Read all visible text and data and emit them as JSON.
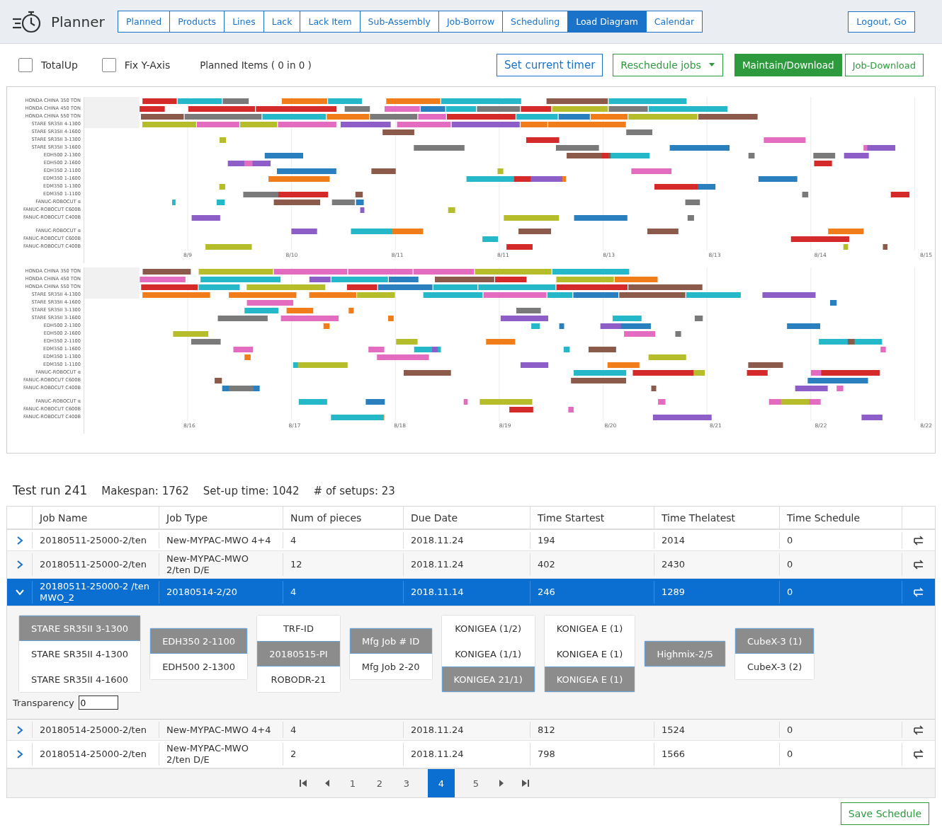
{
  "app": {
    "title": "Planner"
  },
  "nav": [
    {
      "label": "Planned",
      "selected": false
    },
    {
      "label": "Products",
      "selected": false
    },
    {
      "label": "Lines",
      "selected": false
    },
    {
      "label": "Lack",
      "selected": false
    },
    {
      "label": "Lack  Item",
      "selected": false
    },
    {
      "label": "Sub-Assembly",
      "selected": false
    },
    {
      "label": "Job-Borrow",
      "selected": false
    },
    {
      "label": "Scheduling",
      "selected": false
    },
    {
      "label": "Load Diagram",
      "selected": true
    },
    {
      "label": "Calendar",
      "selected": false
    }
  ],
  "logout": "Logout,  Go",
  "toolbar": {
    "checkboxes": [
      {
        "label": "TotalUp",
        "checked": false
      },
      {
        "label": "Fix Y-Axis",
        "checked": false
      }
    ],
    "planned_items": "Planned Items  ( 0 in 0 )",
    "set_timer": "Set current timer",
    "reschedule": "Reschedule jobs",
    "maintain": "Maintain/Download",
    "job_download": "Job-Download"
  },
  "gantt": {
    "panels": [
      {
        "row_groups": [
          [
            "HONDA CHINA  350 TON",
            "HONDA CHINA  450 TON",
            "HONDA CHINA  550 TON",
            "STARE  SR35II 4-1300",
            "STARE  SR35II 4-1600",
            "STARE  SR35II 3-1300",
            "STARE  SR35II 3-1600",
            "EDH500  2-1300",
            "EDH500  2-1600",
            "EDH350  2-1100",
            "EDM350  1-1600",
            "EDM350  1-1300",
            "EDM350  1-1100",
            "FANUC-ROBOCUT  α",
            "FANUC-ROBOCUT  C600B",
            "FANUC-ROBOCUT  C400B"
          ],
          [
            "FANUC-ROBOCUT  α",
            "FANUC-ROBOCUT  C600B",
            "FANUC-ROBOCUT  C400B"
          ]
        ],
        "ticks": [
          "8/9",
          "8/10",
          "8/11",
          "8/11",
          "8/13",
          "8/13",
          "8/14",
          "8/15"
        ]
      },
      {
        "row_groups": [
          [
            "HONDA CHINA  350 TON",
            "HONDA CHINA  450 TON",
            "HONDA CHINA  550 TON",
            "STARE  SR35II 4-1300",
            "STARE  SR35II 4-1600",
            "STARE  SR35II 3-1300",
            "STARE  SR35II 3-1600",
            "EDH500  2-1300",
            "EDH500  2-1600",
            "EDH350  2-1100",
            "EDM350  1-1600",
            "EDM350  1-1300",
            "EDM350  1-1100",
            "FANUC-ROBOCUT  α",
            "FANUC-ROBOCUT  C600B",
            "FANUC-ROBOCUT  C400B"
          ],
          [
            "FANUC-ROBOCUT  α",
            "FANUC-ROBOCUT  C600B",
            "FANUC-ROBOCUT  C400B"
          ]
        ],
        "ticks": [
          "8/16",
          "8/17",
          "8/18",
          "8/19",
          "8/20",
          "8/21",
          "8/22",
          "8/22"
        ]
      }
    ]
  },
  "summary": {
    "title": "Test run 241",
    "makespan": "Makespan: 1762",
    "setup_time": "Set-up time: 1042",
    "setups": "# of setups: 23"
  },
  "table": {
    "columns": [
      "Job Name",
      "Job Type",
      "Num of pieces",
      "Due Date",
      "Time Startest",
      "Time Thelatest",
      "Time Schedule"
    ],
    "rows": [
      {
        "expanded": false,
        "cells": [
          "20180511-25000-2/ten",
          "New-MYPAC-MWO 4+4",
          "4",
          "2018.11.24",
          "194",
          "2014",
          "0"
        ]
      },
      {
        "expanded": false,
        "cells": [
          "20180511-25000-2/ten",
          "New-MYPAC-MWO 2/ten D/E",
          "12",
          "2018.11.24",
          "402",
          "2430",
          "0"
        ]
      },
      {
        "expanded": true,
        "cells": [
          "20180511-25000-2 /ten  MWO_2",
          "20180514-2/20",
          "4",
          "2018.11.14",
          "246",
          "1289",
          "0"
        ],
        "detail": {
          "groups": [
            [
              {
                "label": "STARE SR35II 3-1300",
                "selected": true
              },
              {
                "label": "STARE SR35II 4-1300",
                "selected": false
              },
              {
                "label": "STARE SR35II 4-1600",
                "selected": false
              }
            ],
            [
              {
                "label": "EDH350 2-1100",
                "selected": true
              },
              {
                "label": "EDH500 2-1300",
                "selected": false
              }
            ],
            [
              {
                "label": "TRF-ID",
                "selected": false
              },
              {
                "label": "20180515-PI",
                "selected": true
              },
              {
                "label": "ROBODR-21",
                "selected": false
              }
            ],
            [
              {
                "label": "Mfg Job # ID",
                "selected": true
              },
              {
                "label": "Mfg Job 2-20",
                "selected": false
              }
            ],
            [
              {
                "label": "KONIGEA  (1/2)",
                "selected": false
              },
              {
                "label": "KONIGEA  (1/1)",
                "selected": false
              },
              {
                "label": "KONIGEA  21/1)",
                "selected": true
              }
            ],
            [
              {
                "label": "KONIGEA E  (1)",
                "selected": false
              },
              {
                "label": "KONIGEA E  (1)",
                "selected": false
              },
              {
                "label": "KONIGEA E  (1)",
                "selected": true
              }
            ],
            [
              {
                "label": "Highmix-2/5",
                "selected": true
              }
            ],
            [
              {
                "label": "CubeX-3  (1)",
                "selected": true
              },
              {
                "label": "CubeX-3  (2)",
                "selected": false
              }
            ]
          ],
          "transparency_label": "Transparency",
          "transparency_value": "0"
        }
      },
      {
        "expanded": false,
        "cells": [
          "20180514-25000-2/ten",
          "New-MYPAC-MWO 4+4",
          "4",
          "2018.11.24",
          "812",
          "1524",
          "0"
        ]
      },
      {
        "expanded": false,
        "cells": [
          "20180514-25000-2/ten",
          "New-MYPAC-MWO 2/ten D/E",
          "2",
          "2018.11.24",
          "798",
          "1566",
          "0"
        ]
      }
    ]
  },
  "pagination": [
    {
      "label": "1",
      "selected": false
    },
    {
      "label": "2",
      "selected": false
    },
    {
      "label": "3",
      "selected": false
    },
    {
      "label": "4",
      "selected": true
    },
    {
      "label": "5",
      "selected": false
    }
  ],
  "save": "Save Schedule"
}
